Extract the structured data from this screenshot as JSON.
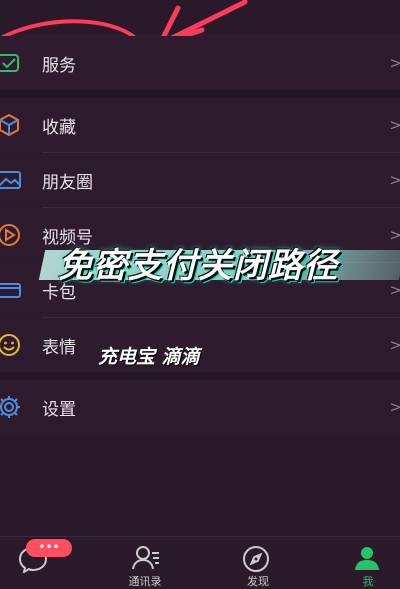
{
  "menu": {
    "items": [
      {
        "label": "服务"
      },
      {
        "label": "收藏"
      },
      {
        "label": "朋友圈"
      },
      {
        "label": "视频号"
      },
      {
        "label": "卡包"
      },
      {
        "label": "表情"
      },
      {
        "label": "设置"
      }
    ],
    "chevron": ">"
  },
  "overlay": {
    "title": "免密支付关闭路径",
    "subtitle": "充电宝 滴滴"
  },
  "tabbar": {
    "tabs": [
      {
        "label": ""
      },
      {
        "label": "通讯录"
      },
      {
        "label": "发现"
      },
      {
        "label": "我"
      }
    ],
    "badge": "•••"
  },
  "colors": {
    "background": "#2e1c2e",
    "annotation": "#ff3b59",
    "accent": "#27c26a"
  }
}
